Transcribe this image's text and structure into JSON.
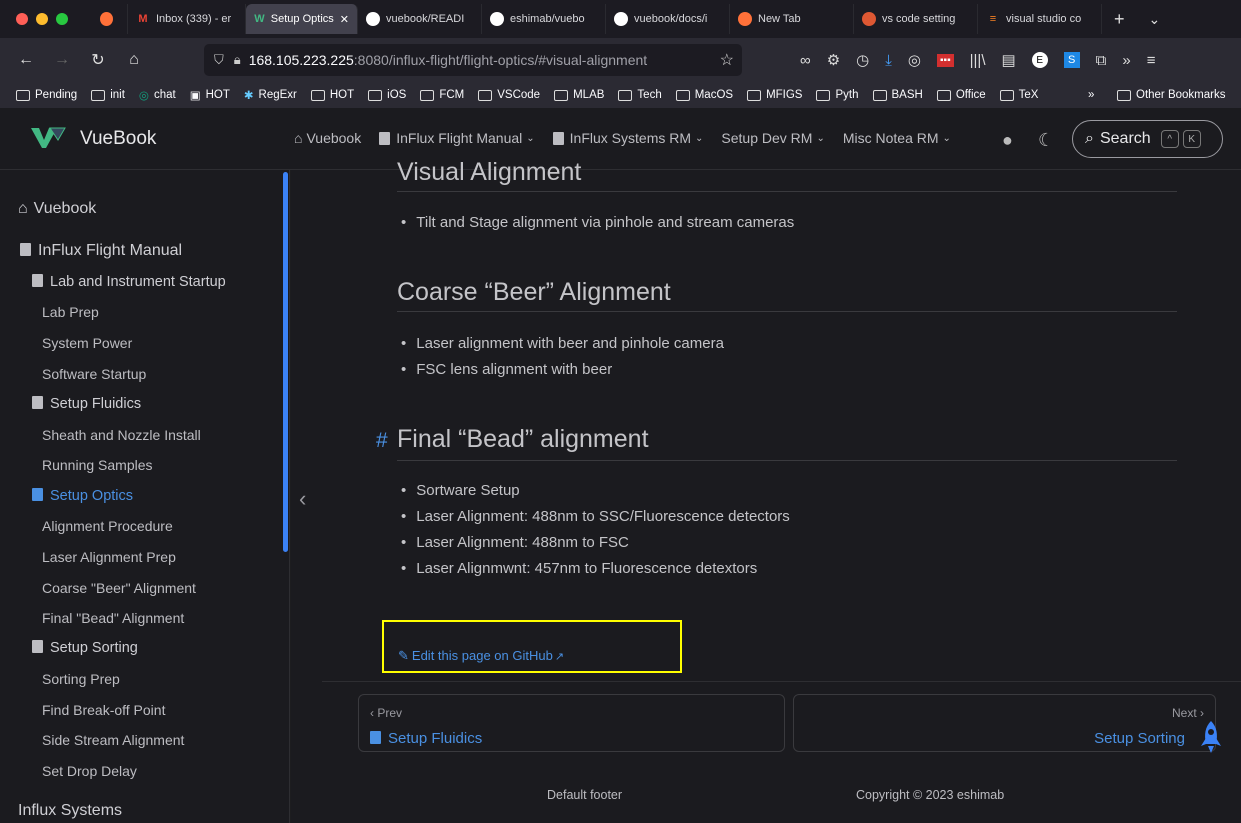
{
  "browser": {
    "tabs": [
      {
        "label": "",
        "icon": "firefox-icon"
      },
      {
        "label": "Inbox (339) - er",
        "icon": "gmail-icon"
      },
      {
        "label": "Setup Optics",
        "icon": "vuebook-icon",
        "active": true
      },
      {
        "label": "vuebook/READI",
        "icon": "github-icon"
      },
      {
        "label": "eshimab/vuebo",
        "icon": "github-icon"
      },
      {
        "label": "vuebook/docs/i",
        "icon": "github-icon"
      },
      {
        "label": "New Tab",
        "icon": "firefox-icon"
      },
      {
        "label": "vs code setting",
        "icon": "duckduckgo-icon"
      },
      {
        "label": "visual studio co",
        "icon": "stackoverflow-icon"
      }
    ],
    "url_host": "168.105.223.225",
    "url_path": ":8080/influx-flight/flight-optics/#visual-alignment",
    "bookmarks": [
      "Pending",
      "init",
      "chat",
      "HOT",
      "RegExr",
      "HOT",
      "iOS",
      "FCM",
      "VSCode",
      "MLAB",
      "Tech",
      "MacOS",
      "MFIGS",
      "Pyth",
      "BASH",
      "Office",
      "TeX"
    ],
    "other_bookmarks": "Other Bookmarks"
  },
  "app": {
    "brand": "VueBook",
    "nav": [
      {
        "label": "Vuebook",
        "icon": "home-icon"
      },
      {
        "label": "InFlux Flight Manual",
        "icon": "book-icon",
        "dropdown": true
      },
      {
        "label": "InFlux Systems RM",
        "icon": "book-icon",
        "dropdown": true
      },
      {
        "label": "Setup Dev RM",
        "dropdown": true
      },
      {
        "label": "Misc Notea RM",
        "dropdown": true
      }
    ],
    "search_label": "Search",
    "search_keys": [
      "^",
      "K"
    ]
  },
  "sidebar": {
    "items": [
      {
        "label": "Vuebook",
        "level": 0,
        "icon": "home-icon"
      },
      {
        "label": "InFlux Flight Manual",
        "level": 0,
        "icon": "book-icon"
      },
      {
        "label": "Lab and Instrument Startup",
        "level": 1,
        "icon": "book-icon"
      },
      {
        "label": "Lab Prep",
        "level": 2
      },
      {
        "label": "System Power",
        "level": 2
      },
      {
        "label": "Software Startup",
        "level": 2
      },
      {
        "label": "Setup Fluidics",
        "level": 1,
        "icon": "book-icon"
      },
      {
        "label": "Sheath and Nozzle Install",
        "level": 2
      },
      {
        "label": "Running Samples",
        "level": 2
      },
      {
        "label": "Setup Optics",
        "level": 1,
        "icon": "book-icon",
        "active": true
      },
      {
        "label": "Alignment Procedure",
        "level": 2
      },
      {
        "label": "Laser Alignment Prep",
        "level": 2
      },
      {
        "label": "Coarse \"Beer\" Alignment",
        "level": 2
      },
      {
        "label": "Final \"Bead\" Alignment",
        "level": 2
      },
      {
        "label": "Setup Sorting",
        "level": 1,
        "icon": "book-icon"
      },
      {
        "label": "Sorting Prep",
        "level": 2
      },
      {
        "label": "Find Break-off Point",
        "level": 2
      },
      {
        "label": "Side Stream Alignment",
        "level": 2
      },
      {
        "label": "Set Drop Delay",
        "level": 2
      },
      {
        "label": "Influx Systems",
        "level": 0
      }
    ]
  },
  "content": {
    "sections": [
      {
        "heading": "Visual Alignment",
        "bullets": [
          "Tilt and Stage alignment via pinhole and stream cameras"
        ]
      },
      {
        "heading": "Coarse “Beer” Alignment",
        "bullets": [
          "Laser alignment with beer and pinhole camera",
          "FSC lens alignment with beer"
        ]
      },
      {
        "heading": "Final “Bead” alignment",
        "anchor": "#",
        "bullets": [
          "Sortware Setup",
          "Laser Alignment: 488nm to SSC/Fluorescence detectors",
          "Laser Alignment: 488nm to FSC",
          "Laser Alignmwnt: 457nm to Fluorescence detextors"
        ]
      }
    ],
    "edit_link": "Edit this page on GitHub",
    "prev_label": "‹ Prev",
    "prev_title": "Setup Fluidics",
    "next_label": "Next ›",
    "next_title": "Setup Sorting"
  },
  "footer": {
    "left": "Default footer",
    "right": "Copyright © 2023 eshimab"
  },
  "colors": {
    "accent": "#4a90e2",
    "highlight_box": "#ffff00",
    "background": "#1b1b1f"
  }
}
